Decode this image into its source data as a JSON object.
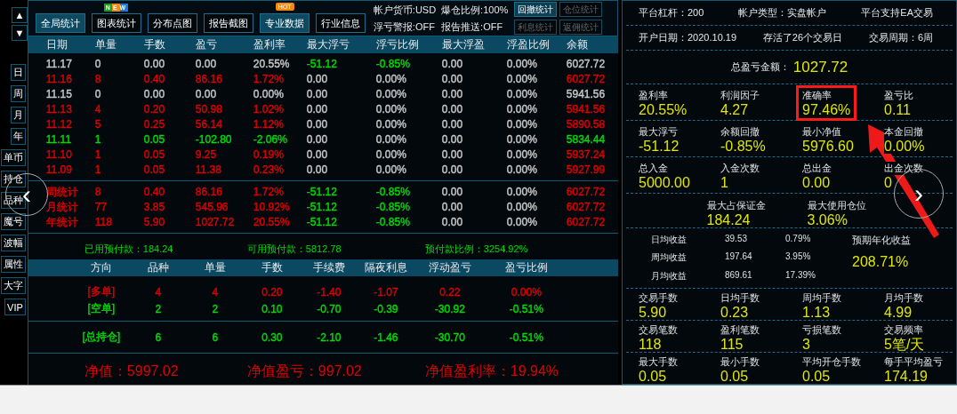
{
  "scroll_buttons": [
    "▲",
    "▼"
  ],
  "tabs": [
    {
      "label": "全局统计",
      "selected": true
    },
    {
      "label": "图表统计",
      "selected": false,
      "badge": "NEW"
    },
    {
      "label": "分布点图",
      "selected": false
    },
    {
      "label": "报告截图",
      "selected": false
    },
    {
      "label": "专业数据",
      "selected": true,
      "badge": "HOT"
    },
    {
      "label": "行业信息",
      "selected": false
    }
  ],
  "account_info": [
    "帐户货币:USD",
    "爆仓比例:100%",
    "浮亏警报:OFF",
    "报告推送:OFF"
  ],
  "stat_buttons": [
    {
      "label": "回撤统计",
      "disabled": false
    },
    {
      "label": "仓位统计",
      "disabled": true
    },
    {
      "label": "利息统计",
      "disabled": true
    },
    {
      "label": "返佣统计",
      "disabled": true
    }
  ],
  "side_buttons": [
    "日",
    "周",
    "月",
    "年",
    "单币",
    "持仓",
    "品种",
    "魔号",
    "波幅",
    "属性",
    "大字",
    "VIP"
  ],
  "nav": {
    "previous": "‹",
    "next": "›"
  },
  "daily_table": {
    "columns": [
      "日期",
      "单量",
      "手数",
      "盈亏",
      "盈利率",
      "最大浮亏",
      "浮亏比例",
      "最大浮盈",
      "浮盈比例",
      "余额"
    ],
    "rows": [
      {
        "cells": [
          {
            "text": "11.17",
            "color": "#c8c8c8"
          },
          {
            "text": "0",
            "color": "#c8c8c8"
          },
          {
            "text": "0.00",
            "color": "#c8c8c8"
          },
          {
            "text": "0.00",
            "color": "#c8c8c8"
          },
          {
            "text": "20.55%",
            "color": "#c8c8c8"
          },
          {
            "text": "-51.12",
            "color": "#00dd00"
          },
          {
            "text": "-0.85%",
            "color": "#00dd00"
          },
          {
            "text": "0.00",
            "color": "#c8c8c8"
          },
          {
            "text": "0.00%",
            "color": "#c8c8c8"
          },
          {
            "text": "6027.72",
            "color": "#c8c8c8"
          }
        ]
      },
      {
        "cells": [
          {
            "text": "11.16",
            "color": "#e00000"
          },
          {
            "text": "8",
            "color": "#e00000"
          },
          {
            "text": "0.40",
            "color": "#e00000"
          },
          {
            "text": "86.16",
            "color": "#e00000"
          },
          {
            "text": "1.72%",
            "color": "#e00000"
          },
          {
            "text": "0.00",
            "color": "#c8c8c8"
          },
          {
            "text": "0.00%",
            "color": "#c8c8c8"
          },
          {
            "text": "0.00",
            "color": "#c8c8c8"
          },
          {
            "text": "0.00%",
            "color": "#c8c8c8"
          },
          {
            "text": "6027.72",
            "color": "#e00000"
          }
        ]
      },
      {
        "cells": [
          {
            "text": "11.15",
            "color": "#c8c8c8"
          },
          {
            "text": "0",
            "color": "#c8c8c8"
          },
          {
            "text": "0.00",
            "color": "#c8c8c8"
          },
          {
            "text": "0.00",
            "color": "#c8c8c8"
          },
          {
            "text": "0.00%",
            "color": "#c8c8c8"
          },
          {
            "text": "0.00",
            "color": "#c8c8c8"
          },
          {
            "text": "0.00%",
            "color": "#c8c8c8"
          },
          {
            "text": "0.00",
            "color": "#c8c8c8"
          },
          {
            "text": "0.00%",
            "color": "#c8c8c8"
          },
          {
            "text": "5941.56",
            "color": "#c8c8c8"
          }
        ]
      },
      {
        "cells": [
          {
            "text": "11.13",
            "color": "#e00000"
          },
          {
            "text": "4",
            "color": "#e00000"
          },
          {
            "text": "0.20",
            "color": "#e00000"
          },
          {
            "text": "50.98",
            "color": "#e00000"
          },
          {
            "text": "1.02%",
            "color": "#e00000"
          },
          {
            "text": "0.00",
            "color": "#c8c8c8"
          },
          {
            "text": "0.00%",
            "color": "#c8c8c8"
          },
          {
            "text": "0.00",
            "color": "#c8c8c8"
          },
          {
            "text": "0.00%",
            "color": "#c8c8c8"
          },
          {
            "text": "5941.56",
            "color": "#e00000"
          }
        ]
      },
      {
        "cells": [
          {
            "text": "11.12",
            "color": "#e00000"
          },
          {
            "text": "5",
            "color": "#e00000"
          },
          {
            "text": "0.25",
            "color": "#e00000"
          },
          {
            "text": "56.14",
            "color": "#e00000"
          },
          {
            "text": "1.12%",
            "color": "#e00000"
          },
          {
            "text": "0.00",
            "color": "#c8c8c8"
          },
          {
            "text": "0.00%",
            "color": "#c8c8c8"
          },
          {
            "text": "0.00",
            "color": "#c8c8c8"
          },
          {
            "text": "0.00%",
            "color": "#c8c8c8"
          },
          {
            "text": "5890.58",
            "color": "#e00000"
          }
        ]
      },
      {
        "cells": [
          {
            "text": "11.11",
            "color": "#00dd00"
          },
          {
            "text": "1",
            "color": "#00dd00"
          },
          {
            "text": "0.05",
            "color": "#00dd00"
          },
          {
            "text": "-102.80",
            "color": "#00dd00"
          },
          {
            "text": "-2.06%",
            "color": "#00dd00"
          },
          {
            "text": "0.00",
            "color": "#c8c8c8"
          },
          {
            "text": "0.00%",
            "color": "#c8c8c8"
          },
          {
            "text": "0.00",
            "color": "#c8c8c8"
          },
          {
            "text": "0.00%",
            "color": "#c8c8c8"
          },
          {
            "text": "5834.44",
            "color": "#00dd00"
          }
        ]
      },
      {
        "cells": [
          {
            "text": "11.10",
            "color": "#e00000"
          },
          {
            "text": "1",
            "color": "#e00000"
          },
          {
            "text": "0.05",
            "color": "#e00000"
          },
          {
            "text": "9.25",
            "color": "#e00000"
          },
          {
            "text": "0.19%",
            "color": "#e00000"
          },
          {
            "text": "0.00",
            "color": "#c8c8c8"
          },
          {
            "text": "0.00%",
            "color": "#c8c8c8"
          },
          {
            "text": "0.00",
            "color": "#c8c8c8"
          },
          {
            "text": "0.00%",
            "color": "#c8c8c8"
          },
          {
            "text": "5937.24",
            "color": "#e00000"
          }
        ]
      },
      {
        "cells": [
          {
            "text": "11.09",
            "color": "#e00000"
          },
          {
            "text": "1",
            "color": "#e00000"
          },
          {
            "text": "0.05",
            "color": "#e00000"
          },
          {
            "text": "11.38",
            "color": "#e00000"
          },
          {
            "text": "0.23%",
            "color": "#e00000"
          },
          {
            "text": "0.00",
            "color": "#c8c8c8"
          },
          {
            "text": "0.00%",
            "color": "#c8c8c8"
          },
          {
            "text": "0.00",
            "color": "#c8c8c8"
          },
          {
            "text": "0.00%",
            "color": "#c8c8c8"
          },
          {
            "text": "5927.99",
            "color": "#e00000"
          }
        ]
      }
    ],
    "summary_rows": [
      {
        "cells": [
          {
            "text": "周统计",
            "color": "#e00000"
          },
          {
            "text": "8",
            "color": "#e00000"
          },
          {
            "text": "0.40",
            "color": "#e00000"
          },
          {
            "text": "86.16",
            "color": "#e00000"
          },
          {
            "text": "1.72%",
            "color": "#e00000"
          },
          {
            "text": "-51.12",
            "color": "#00dd00"
          },
          {
            "text": "-0.85%",
            "color": "#00dd00"
          },
          {
            "text": "0.00",
            "color": "#c8c8c8"
          },
          {
            "text": "0.00%",
            "color": "#c8c8c8"
          },
          {
            "text": "6027.72",
            "color": "#e00000"
          }
        ]
      },
      {
        "cells": [
          {
            "text": "月统计",
            "color": "#e00000"
          },
          {
            "text": "77",
            "color": "#e00000"
          },
          {
            "text": "3.85",
            "color": "#e00000"
          },
          {
            "text": "545.96",
            "color": "#e00000"
          },
          {
            "text": "10.92%",
            "color": "#e00000"
          },
          {
            "text": "-51.12",
            "color": "#00dd00"
          },
          {
            "text": "-0.85%",
            "color": "#00dd00"
          },
          {
            "text": "0.00",
            "color": "#c8c8c8"
          },
          {
            "text": "0.00%",
            "color": "#c8c8c8"
          },
          {
            "text": "6027.72",
            "color": "#e00000"
          }
        ]
      },
      {
        "cells": [
          {
            "text": "年统计",
            "color": "#e00000"
          },
          {
            "text": "118",
            "color": "#e00000"
          },
          {
            "text": "5.90",
            "color": "#e00000"
          },
          {
            "text": "1027.72",
            "color": "#e00000"
          },
          {
            "text": "20.55%",
            "color": "#e00000"
          },
          {
            "text": "-51.12",
            "color": "#00dd00"
          },
          {
            "text": "-0.85%",
            "color": "#00dd00"
          },
          {
            "text": "0.00",
            "color": "#c8c8c8"
          },
          {
            "text": "0.00%",
            "color": "#c8c8c8"
          },
          {
            "text": "6027.72",
            "color": "#e00000"
          }
        ]
      }
    ]
  },
  "margin_line": [
    "已用预付款：184.24",
    "可用预付款：5812.78",
    "预付款比例：3254.92%"
  ],
  "positions_table": {
    "columns": [
      "方向",
      "品种",
      "单量",
      "手数",
      "手续费",
      "隔夜利息",
      "浮动盈亏",
      "盈亏比例"
    ],
    "rows": [
      {
        "kind": "side",
        "color": "#e00000",
        "cells": [
          "[多单]",
          "4",
          "4",
          "0.20",
          "-1.40",
          "-1.07",
          "0.22",
          "0.00%"
        ]
      },
      {
        "kind": "side",
        "color": "#00dd00",
        "cells": [
          "[空单]",
          "2",
          "2",
          "0.10",
          "-0.70",
          "-0.39",
          "-30.92",
          "-0.51%"
        ]
      },
      {
        "kind": "total",
        "color": "#00dd00",
        "cells": [
          "[总持仓]",
          "6",
          "6",
          "0.30",
          "-2.10",
          "-1.46",
          "-30.70",
          "-0.51%"
        ]
      }
    ]
  },
  "net_line": [
    "净值：5997.02",
    "净值盈亏：997.02",
    "净值盈利率：19.94%"
  ],
  "account_panel": {
    "info_rows": [
      [
        "平台杠杆：200",
        "帐户类型：实盘帐户",
        "平台支持EA交易"
      ],
      [
        "开户日期：2020.10.19",
        "存活了26个交易日",
        "交易周期：6周"
      ]
    ],
    "total": {
      "label": "总盈亏金额：",
      "value": "1027.72"
    },
    "metric_rows": [
      [
        {
          "label": "盈利率",
          "value": "20.55%",
          "highlighted": false
        },
        {
          "label": "利润因子",
          "value": "4.27",
          "highlighted": false
        },
        {
          "label": "准确率",
          "value": "97.46%",
          "highlighted": true
        },
        {
          "label": "盈亏比",
          "value": "0.11",
          "highlighted": false
        }
      ],
      [
        {
          "label": "最大浮亏",
          "value": "-51.12",
          "highlighted": false
        },
        {
          "label": "余额回撤",
          "value": "-0.85%",
          "highlighted": false
        },
        {
          "label": "最小净值",
          "value": "5976.60",
          "highlighted": false
        },
        {
          "label": "本金回撤",
          "value": "0.00%",
          "highlighted": false
        }
      ],
      [
        {
          "label": "总入金",
          "value": "5000.00",
          "highlighted": false
        },
        {
          "label": "入金次数",
          "value": "1",
          "highlighted": false
        },
        {
          "label": "总出金",
          "value": "0.00",
          "highlighted": false
        },
        {
          "label": "出金次数",
          "value": "0",
          "highlighted": false
        }
      ]
    ],
    "margin_metrics": [
      {
        "label": "最大占保证金",
        "value": "184.24"
      },
      {
        "label": "最大使用仓位",
        "value": "3.06%"
      }
    ],
    "averages": [
      [
        "日均收益",
        "39.53",
        "0.79%"
      ],
      [
        "周均收益",
        "197.64",
        "3.95%"
      ],
      [
        "月均收益",
        "869.61",
        "17.39%"
      ]
    ],
    "expected": {
      "label": "预期年化收益",
      "value": "208.71%"
    },
    "lot_rows": [
      [
        {
          "label": "交易手数",
          "value": "5.90"
        },
        {
          "label": "日均手数",
          "value": "0.23"
        },
        {
          "label": "周均手数",
          "value": "1.13"
        },
        {
          "label": "月均手数",
          "value": "4.99"
        }
      ],
      [
        {
          "label": "交易笔数",
          "value": "118"
        },
        {
          "label": "盈利笔数",
          "value": "115"
        },
        {
          "label": "亏损笔数",
          "value": "3"
        },
        {
          "label": "交易频率",
          "value": "5笔/天"
        }
      ],
      [
        {
          "label": "最大手数",
          "value": "0.05"
        },
        {
          "label": "最小手数",
          "value": "0.05"
        },
        {
          "label": "平均开仓手数",
          "value": "0.05"
        },
        {
          "label": "每手平均盈亏",
          "value": "174.19"
        }
      ]
    ]
  }
}
